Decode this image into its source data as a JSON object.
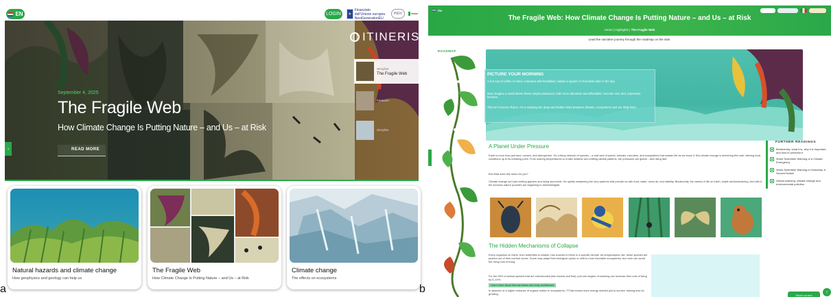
{
  "panel_a": {
    "label": "a",
    "lang": "EN",
    "login": "LOGIN",
    "eu_text": "Finanziato dall'Unione europea NextGenerationEU",
    "partner_1": "INGV",
    "partner_2": "",
    "logo": "ITINERIS",
    "hero": {
      "date": "September 4, 2025",
      "title": "The Fragile Web",
      "subtitle": "How Climate Change Is Putting Nature – and Us – at Risk",
      "read_more": "READ MORE"
    },
    "side_stories": [
      {
        "tag": "Storyline",
        "name": "The Fragile Web"
      },
      {
        "tag": "Features",
        "name": ""
      },
      {
        "tag": "Storyline",
        "name": ""
      }
    ],
    "cards": [
      {
        "title": "Natural hazards and climate change",
        "sub": "How geophysics and geology can help us"
      },
      {
        "title": "The Fragile Web",
        "sub": "How Climate Change Is Putting Nature – and Us – at Risk"
      },
      {
        "title": "Climate change",
        "sub": "The effects on ecosystems"
      }
    ]
  },
  "panel_b": {
    "label": "b",
    "title": "The Fragile Web: How Climate Change Is Putting Nature – and Us – at Risk",
    "breadcrumb_home": "Home",
    "breadcrumb_mid": "Highlights",
    "breadcrumb_current": "The Fragile Web",
    "hint": "Lead the narrative journey through the roadmap on the side.",
    "roadmap": "ROADMAP",
    "morning": {
      "title": "PICTURE YOUR MORNING",
      "p1": "A hot cup of coffee in hand, a banana with breakfast, maybe a square of chocolate later in the day.",
      "p2": "Now imagine a world where these simple pleasures, both once abundant and affordable, become rare and, expensive luxuries.",
      "p3": "This isn't science fiction. It's a studying the deep and hidden links between climate, ecosystems and our daily lives."
    },
    "section1": {
      "title": "A Planet Under Pressure",
      "p1": "Earth is more than just land, oceans, and atmosphere. It's a living network of species – a vast web of plants, animals, microbes, and ecosystems that sustain life as we know it. But climate change is stretching this web, altering local conditions up to its breaking point. From soaring temperatures to erratic weather and shifting rainfall patterns, the pressures are global – and rising fast.",
      "p2": "But what does this mean for you?",
      "p3": "Climate change isn't just melting glaciers and rising sea levels. It's quietly weakening the very systems that provide us with food, water, clean air, and stability. Biodiversity, the variety of life on Earth, shalls declinedeclining. And with it, the services nature provides are beginning to diminishingfail."
    },
    "section2": {
      "title": "The Hidden Mechanisms of Collapse",
      "p1": "Every organism on Earth, from butterflies to whales, has evolved to thrive in a specific climate. As temperatures rise, these species are pushed out of their comfort zones. Some may adapt their biological cycles or shift to more favorable ecosystems, but none can avoid the rising cost of living.",
      "p2": "For the 95% of animal species that are cold-blooded (like insects and fish), just one degree of warming can increase their cost of living by 6–10%.",
      "learn_more": "Learn more about thermal stress and body architecture",
      "p3": "In absence of a higher entrance of organic matter in ecosystems, ITThat means more energy needed just to survive, leaving less for growing,"
    },
    "further": {
      "title": "FURTHER READINGS",
      "items": [
        "Biodiversity: what it is, why it is important, and how to preserve it",
        "World Scientists' Warning of a Climate Emergency",
        "World Scientists' Warning to Humanity: A Second Notice",
        "Global warming, climate change and environmental pollution"
      ]
    },
    "button": "Share current",
    "colors": {
      "accent": "#2aa84a",
      "teal": "#50bfae"
    }
  }
}
